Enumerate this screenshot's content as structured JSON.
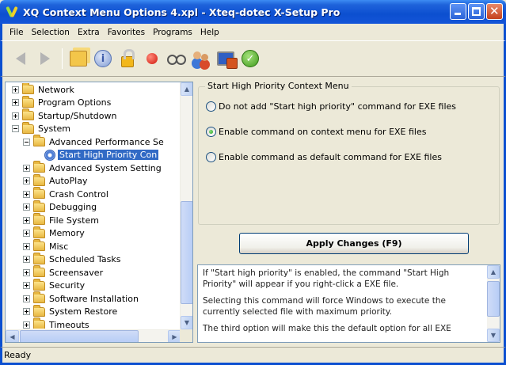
{
  "window": {
    "title": "XQ Context Menu Options 4.xpl - Xteq-dotec X-Setup Pro"
  },
  "menu": [
    "File",
    "Selection",
    "Extra",
    "Favorites",
    "Programs",
    "Help"
  ],
  "toolbar": {
    "icons": [
      "back-arrow-icon",
      "forward-arrow-icon",
      "folders-icon",
      "help-icon",
      "lock-icon",
      "record-icon",
      "glasses-icon",
      "users-icon",
      "monitor-icon",
      "check-icon"
    ]
  },
  "tree": {
    "items": [
      {
        "label": "Network",
        "level": 0,
        "expander": "plus"
      },
      {
        "label": "Program Options",
        "level": 0,
        "expander": "plus"
      },
      {
        "label": "Startup/Shutdown",
        "level": 0,
        "expander": "plus"
      },
      {
        "label": "System",
        "level": 0,
        "expander": "minus"
      },
      {
        "label": "Advanced Performance Se",
        "level": 1,
        "expander": "minus"
      },
      {
        "label": "Start High Priority Con",
        "level": 2,
        "expander": "none",
        "selected": true
      },
      {
        "label": "Advanced System Setting",
        "level": 1,
        "expander": "plus"
      },
      {
        "label": "AutoPlay",
        "level": 1,
        "expander": "plus"
      },
      {
        "label": "Crash Control",
        "level": 1,
        "expander": "plus"
      },
      {
        "label": "Debugging",
        "level": 1,
        "expander": "plus"
      },
      {
        "label": "File System",
        "level": 1,
        "expander": "plus"
      },
      {
        "label": "Memory",
        "level": 1,
        "expander": "plus"
      },
      {
        "label": "Misc",
        "level": 1,
        "expander": "plus"
      },
      {
        "label": "Scheduled Tasks",
        "level": 1,
        "expander": "plus"
      },
      {
        "label": "Screensaver",
        "level": 1,
        "expander": "plus"
      },
      {
        "label": "Security",
        "level": 1,
        "expander": "plus"
      },
      {
        "label": "Software Installation",
        "level": 1,
        "expander": "plus"
      },
      {
        "label": "System Restore",
        "level": 1,
        "expander": "plus"
      },
      {
        "label": "Timeouts",
        "level": 1,
        "expander": "plus"
      }
    ]
  },
  "group": {
    "title": "Start High Priority Context Menu",
    "options": [
      {
        "label": "Do not add \"Start high priority\" command for EXE files",
        "checked": false
      },
      {
        "label": "Enable command on context menu for EXE files",
        "checked": true
      },
      {
        "label": "Enable command as default command for EXE files",
        "checked": false
      }
    ]
  },
  "apply_button": "Apply Changes (F9)",
  "description": [
    "If \"Start high priority\" is enabled, the command \"Start High Priority\" will appear if you right-click a EXE file.",
    "Selecting this command will force Windows to execute the currently selected file with maximum priority.",
    "The third option will make this the default option for all EXE"
  ],
  "status": "Ready"
}
